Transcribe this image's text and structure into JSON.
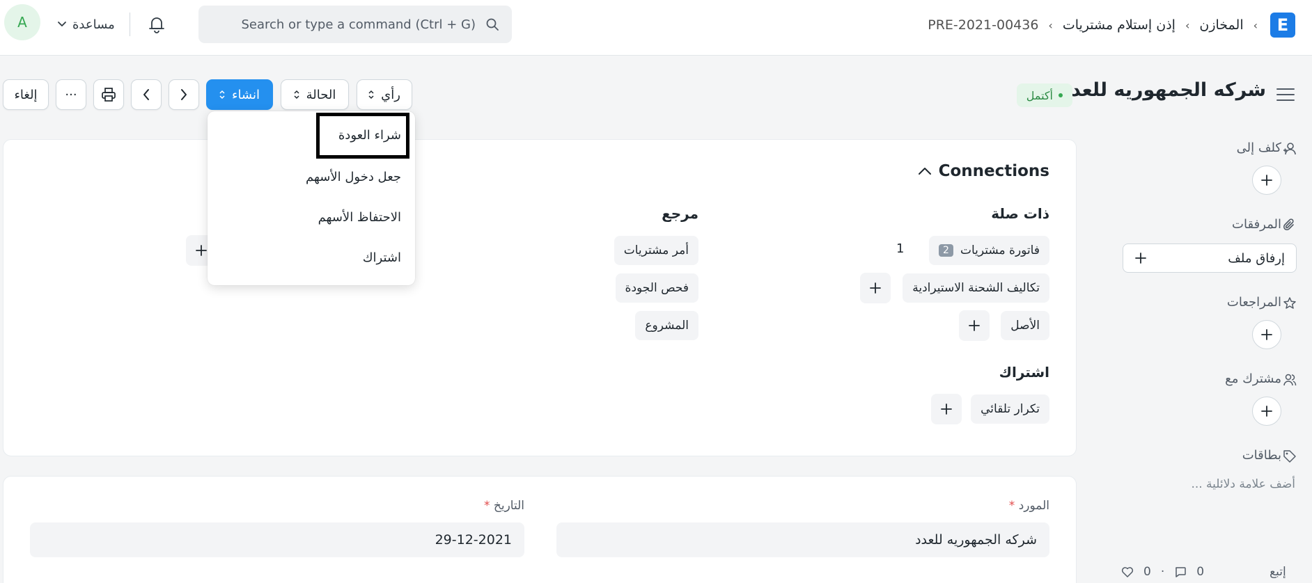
{
  "navbar": {
    "logo_letter": "E",
    "breadcrumbs": [
      "المخازن",
      "إذن إستلام مشتريات",
      "PRE-2021-00436"
    ],
    "search_placeholder": "Search or type a command (Ctrl + G)",
    "help_label": "مساعدة",
    "avatar_letter": "A"
  },
  "page": {
    "title": "شركه الجمهوريه للعدد",
    "status": "أكتمل"
  },
  "toolbar": {
    "view_label": "رأي",
    "status_label": "الحالة",
    "create_label": "انشاء",
    "more_label": "···",
    "cancel_label": "إلغاء"
  },
  "create_menu": {
    "items": [
      "شراء العودة",
      "جعل دخول الأسهم",
      "الاحتفاظ الأسهم",
      "اشتراك"
    ]
  },
  "connections": {
    "title": "Connections",
    "related": {
      "title": "ذات صلة",
      "purchase_invoice": "فاتورة مشتريات",
      "purchase_invoice_badge": "2",
      "purchase_invoice_count": "1",
      "landed_cost": "تكاليف الشحنة الاستيرادية",
      "asset": "الأصل"
    },
    "reference": {
      "title": "مرجع",
      "purchase_order": "أمر مشتريات",
      "quality_inspection": "فحص الجودة",
      "project": "المشروع"
    },
    "subscription": {
      "title": "اشتراك",
      "auto_repeat": "تكرار تلقائي"
    }
  },
  "form": {
    "supplier_label": "المورد",
    "supplier_value": "شركه الجمهوريه للعدد",
    "date_label": "التاريخ",
    "date_value": "29-12-2021"
  },
  "sidebar": {
    "assigned_to": "كلف إلى",
    "attachments": "المرفقات",
    "attach_file": "إرفاق ملف",
    "reviews": "المراجعات",
    "shared_with": "مشترك مع",
    "tags": "بطاقات",
    "add_tag_placeholder": "أضف علامة دلائلية ...",
    "follow": "إتبع",
    "likes_count": "0",
    "comments_count": "0"
  }
}
